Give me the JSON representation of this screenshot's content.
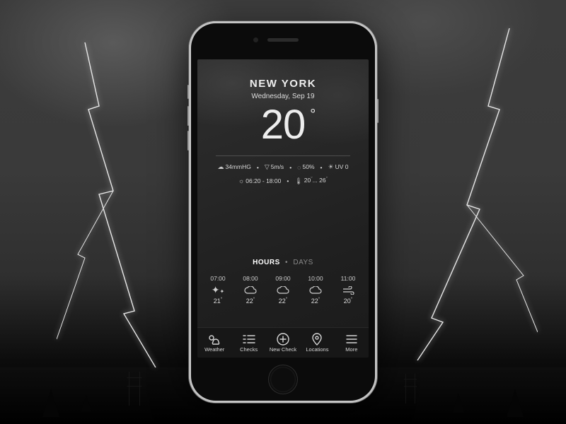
{
  "header": {
    "city": "NEW YORK",
    "date": "Wednesday, Sep 19",
    "temperature": "20",
    "degree_symbol": "°"
  },
  "stats": {
    "pressure": "34mmHG",
    "wind": "5m/s",
    "humidity": "50%",
    "uv": "UV 0",
    "daylight": "06:20 - 18:00",
    "temp_range_low": "20",
    "temp_range_high": "26"
  },
  "forecast_toggle": {
    "active": "HOURS",
    "separator": "•",
    "inactive": "DAYS"
  },
  "hours": [
    {
      "time": "07:00",
      "icon": "stars",
      "temp": "21"
    },
    {
      "time": "08:00",
      "icon": "cloud",
      "temp": "22"
    },
    {
      "time": "09:00",
      "icon": "cloud",
      "temp": "22"
    },
    {
      "time": "10:00",
      "icon": "cloud",
      "temp": "22"
    },
    {
      "time": "11:00",
      "icon": "wind",
      "temp": "20"
    }
  ],
  "tabs": [
    {
      "label": "Weather",
      "icon": "weather"
    },
    {
      "label": "Checks",
      "icon": "checks"
    },
    {
      "label": "New Check",
      "icon": "plus"
    },
    {
      "label": "Locations",
      "icon": "pin"
    },
    {
      "label": "More",
      "icon": "more"
    }
  ]
}
